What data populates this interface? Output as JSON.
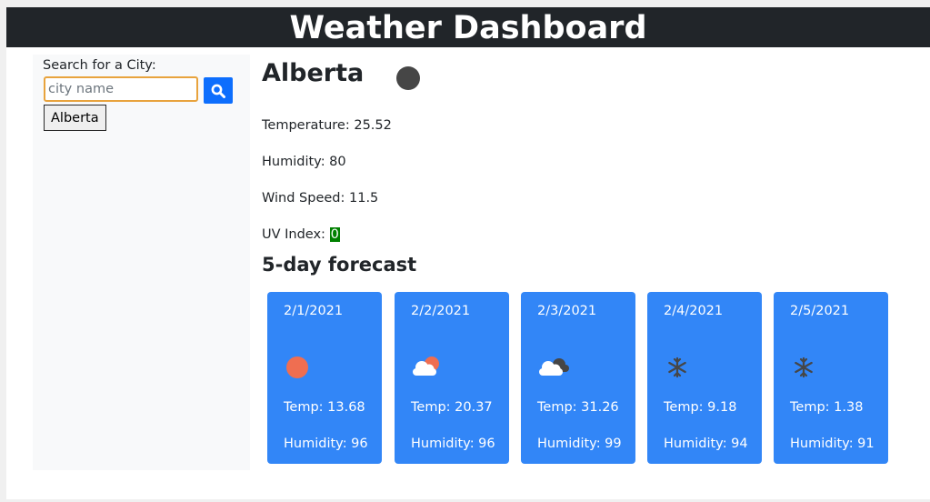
{
  "header": {
    "title": "Weather Dashboard"
  },
  "sidebar": {
    "search_label": "Search for a City:",
    "search_placeholder": "city name",
    "search_value": "",
    "search_button_icon": "search-icon",
    "history": [
      "Alberta"
    ]
  },
  "current": {
    "city": "Alberta",
    "icon": "dark-circle-icon",
    "temperature": "Temperature: 25.52",
    "humidity": "Humidity: 80",
    "wind": "Wind Speed: 11.5",
    "uv_label": "UV Index: ",
    "uv_value": "0",
    "uv_color": "#008000"
  },
  "forecast": {
    "title": "5-day forecast",
    "card_color": "#3286f7",
    "days": [
      {
        "date": "2/1/2021",
        "icon": "sun-icon",
        "temp": "Temp: 13.68",
        "humidity": "Humidity: 96"
      },
      {
        "date": "2/2/2021",
        "icon": "cloud-sun-icon",
        "temp": "Temp: 20.37",
        "humidity": "Humidity: 96"
      },
      {
        "date": "2/3/2021",
        "icon": "cloudy-icon",
        "temp": "Temp: 31.26",
        "humidity": "Humidity: 99"
      },
      {
        "date": "2/4/2021",
        "icon": "snowflake-icon",
        "temp": "Temp: 9.18",
        "humidity": "Humidity: 94"
      },
      {
        "date": "2/5/2021",
        "icon": "snowflake-icon",
        "temp": "Temp: 1.38",
        "humidity": "Humidity: 91"
      }
    ]
  }
}
